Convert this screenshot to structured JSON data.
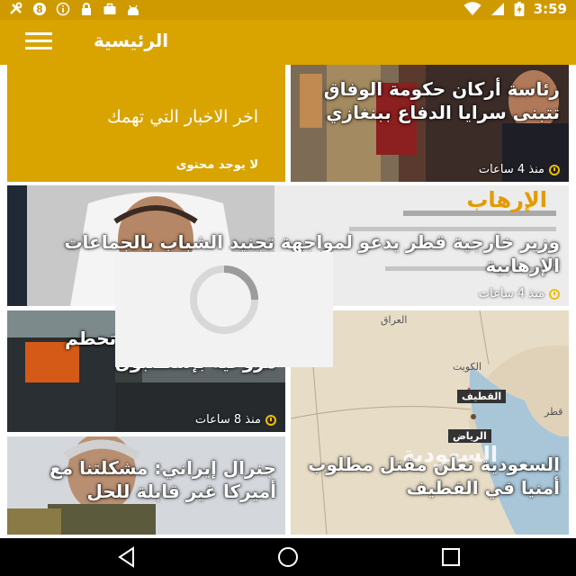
{
  "status_bar": {
    "time": "3:59",
    "left_icons": [
      "tools-icon",
      "signal-8-icon",
      "info-icon",
      "lock-icon",
      "briefcase-icon",
      "android-icon"
    ],
    "right_icons": [
      "wifi-icon",
      "cellular-icon",
      "battery-charging-icon"
    ]
  },
  "app_bar": {
    "title": "الرئيسية",
    "menu_icon": "hamburger-menu-icon"
  },
  "info_card": {
    "title": "اخر الاخبار التي تهمك",
    "subtitle": "لا يوجد محتوى"
  },
  "articles": [
    {
      "headline": "رئاسة أركان حكومة الوفاق تتبنى سرايا الدفاع ببنغازي",
      "time": "منذ 4 ساعات"
    },
    {
      "headline": "وزير خارجية قطر يدعو لمواجهة تجنيد الشباب بالجماعات الإرهابية",
      "time": "منذ 4 ساعات",
      "image_text": "الإرهاب"
    },
    {
      "headline": "قتلى وجرحى في تحطم مروحية بإسطنبول",
      "time": "منذ 8 ساعات"
    },
    {
      "headline": "السعودية تعلن مقتل مطلوب أمنيا في القطيف",
      "time": "",
      "map_labels": {
        "country": "السعودية",
        "iraq": "العراق",
        "kuwait": "الكويت",
        "qatif": "القطيف",
        "riyadh": "الرياض",
        "qatar": "قطر"
      }
    },
    {
      "headline": "جنرال إيراني: مشكلتنا مع أميركا غير قابلة للحل",
      "time": ""
    }
  ],
  "nav_bar": {
    "back": "back-icon",
    "home": "home-icon",
    "recents": "recents-icon"
  },
  "colors": {
    "accent": "#d9a300",
    "status_bar": "#cf9a00",
    "time_icon": "#f2bf00"
  }
}
